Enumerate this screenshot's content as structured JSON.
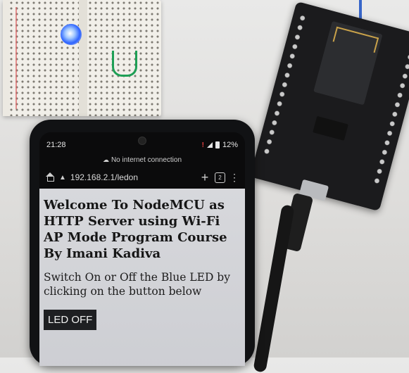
{
  "statusbar": {
    "time": "21:28",
    "battery": "12%",
    "network_notice": "No internet connection"
  },
  "browser": {
    "url": "192.168.2.1/ledon",
    "tab_count": "2"
  },
  "page": {
    "heading": "Welcome To NodeMCU as HTTP Server using Wi-Fi AP Mode Program Course By Imani Kadiva",
    "description": "Switch On or Off the Blue LED by clicking on the button below",
    "button_label": "LED OFF"
  },
  "icons": {
    "home": "home-icon",
    "security": "warning-icon",
    "new_tab": "plus-icon",
    "tabs": "tabs-icon",
    "menu": "more-vert-icon",
    "cloud": "cloud-off-icon"
  }
}
